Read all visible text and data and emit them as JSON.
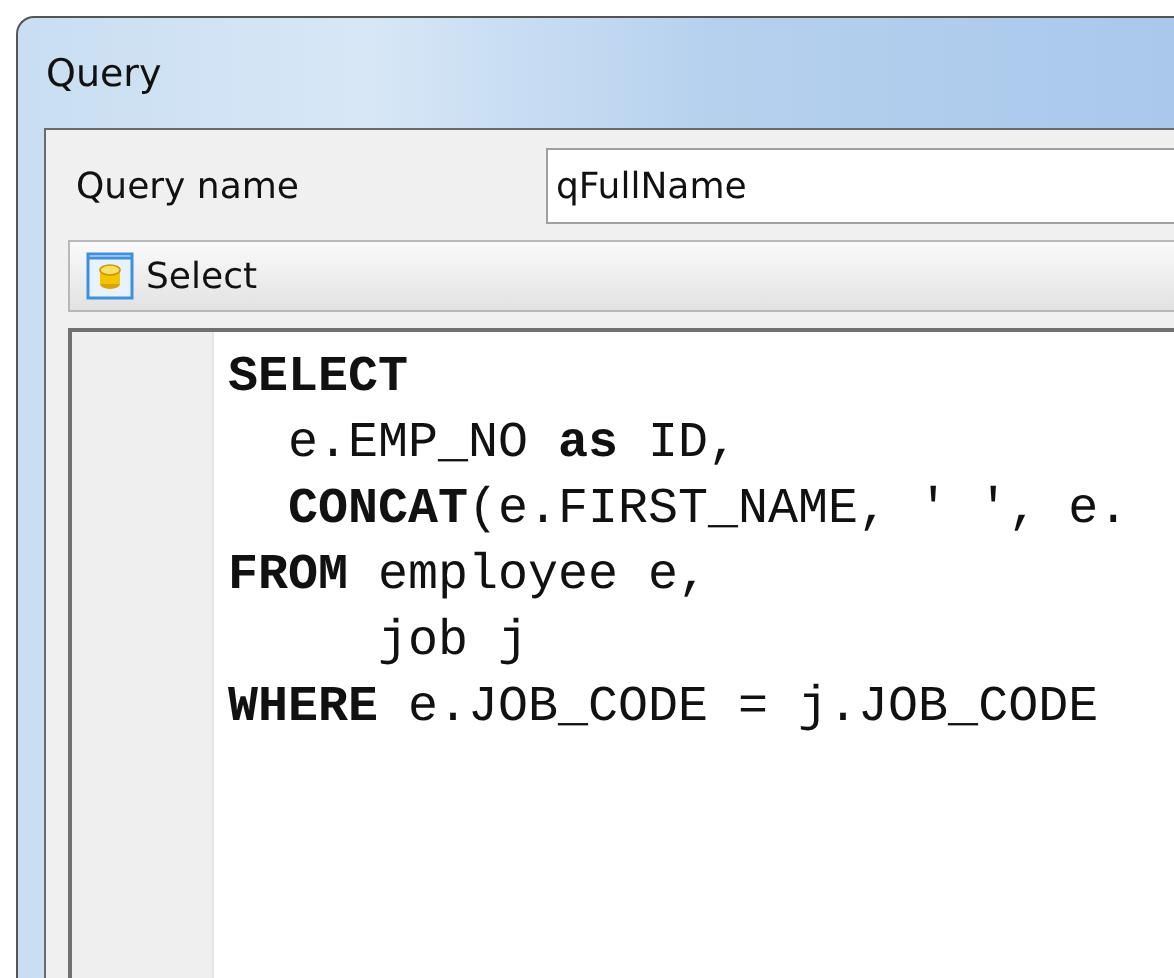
{
  "window": {
    "title": "Query"
  },
  "query_name": {
    "label": "Query name",
    "value": "qFullName"
  },
  "toolbar": [
    {
      "label": "Select"
    }
  ],
  "editor": {
    "lines": [
      "**SELECT**",
      "  e.EMP_NO **as** ID,",
      "  **CONCAT**(e.FIRST_NAME, ' ', e.",
      "**FROM** employee e,",
      "     job j",
      "**WHERE** e.JOB_CODE = j.JOB_CODE"
    ]
  }
}
